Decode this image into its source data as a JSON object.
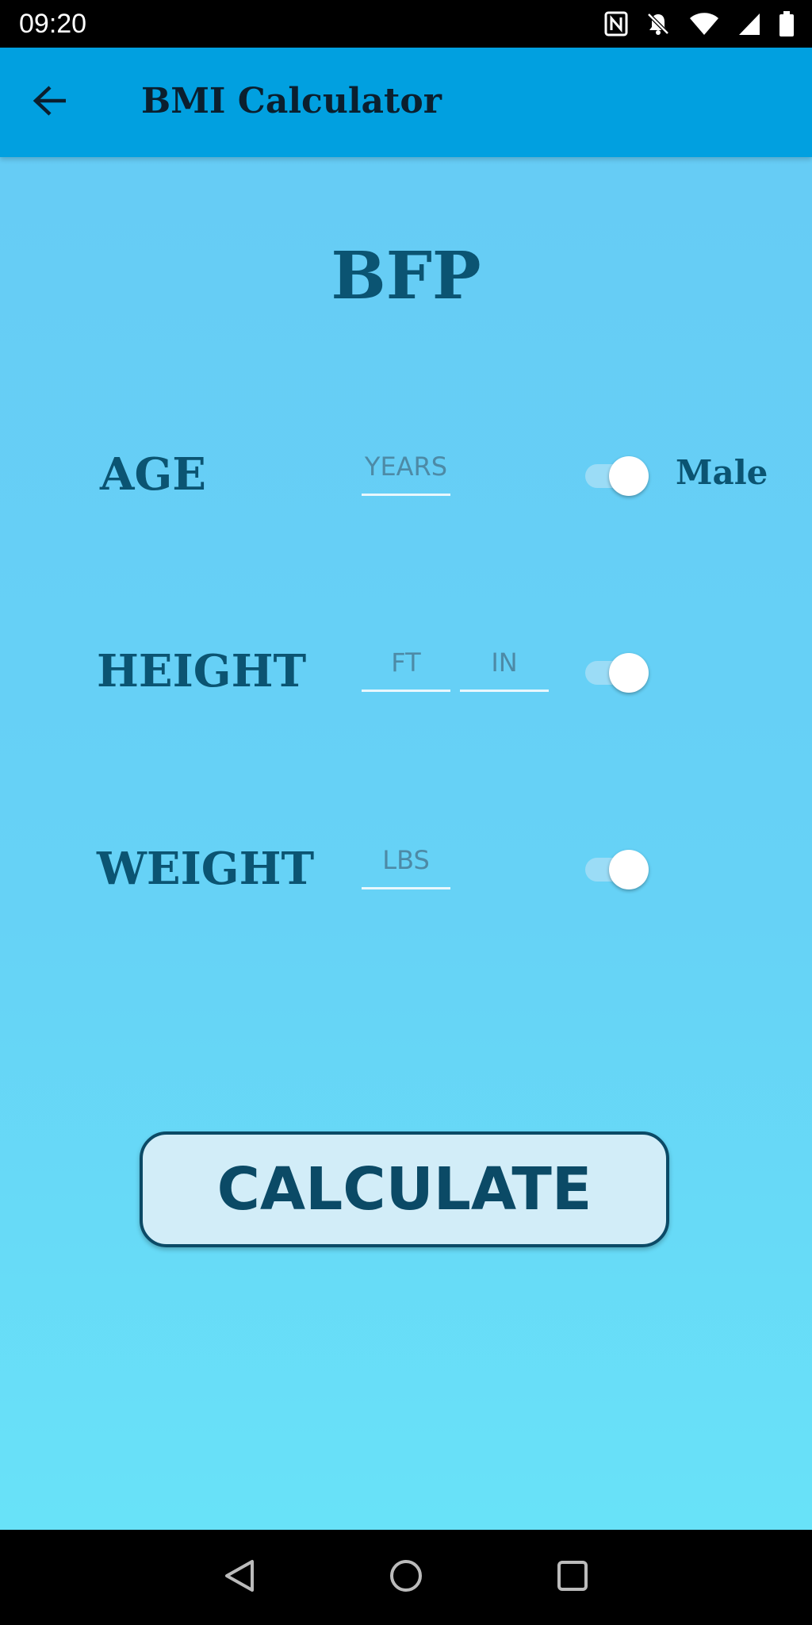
{
  "status_bar": {
    "time": "09:20",
    "icons": [
      "nfc-icon",
      "notifications-off-icon",
      "wifi-icon",
      "signal-icon",
      "battery-icon"
    ]
  },
  "app_bar": {
    "title": "BMI Calculator",
    "back_icon": "arrow-left-icon"
  },
  "main": {
    "heading": "BFP",
    "rows": [
      {
        "label": "AGE",
        "fields": [
          {
            "value": "",
            "placeholder": "YEARS"
          }
        ],
        "toggle_on": true,
        "toggle_label": "Male"
      },
      {
        "label": "HEIGHT",
        "fields": [
          {
            "value": "",
            "placeholder": "FT"
          },
          {
            "value": "",
            "placeholder": "IN"
          }
        ],
        "toggle_on": true
      },
      {
        "label": "WEIGHT",
        "fields": [
          {
            "value": "",
            "placeholder": "LBS"
          }
        ],
        "toggle_on": true
      }
    ],
    "calculate_label": "CALCULATE"
  },
  "nav_bar": {
    "icons": [
      "back-triangle-icon",
      "home-circle-icon",
      "recents-square-icon"
    ]
  },
  "colors": {
    "app_bar": "#01a0e0",
    "content_bg_top": "#66ccf5",
    "content_bg_bottom": "#68e2f8",
    "label_text": "#0b5472",
    "button_bg": "#d2edf8",
    "button_border": "#0b4a66"
  }
}
